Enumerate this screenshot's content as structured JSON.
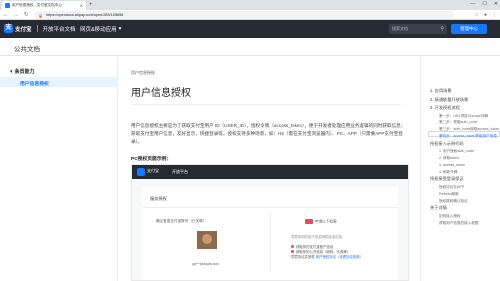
{
  "browser": {
    "tab_title": "用户信息授权 - 支付宝文档中心",
    "url": "https://opendocs.alipay.com/open/289/105656",
    "colors": {
      "accent": "#1677ff",
      "header_bg": "#262a33"
    }
  },
  "header": {
    "brand": "支付宝",
    "platform": "开放平台文档",
    "nav": "网页&移动应用",
    "search_placeholder": "搜索文档",
    "console_button": "管理中心"
  },
  "subheader": {
    "title": "公共文档"
  },
  "sidebar": {
    "group": "会员能力",
    "items": [
      {
        "label": "用户信息授权",
        "active": true
      }
    ]
  },
  "main": {
    "breadcrumb": "用户信息授权",
    "title": "用户信息授权",
    "paragraph": "用户信息授权主要是为了获取支付宝用户 ID（USER_ID），授权令牌（access_token），便于开发者处理应用业务逻辑的同时获取信息；获取支付宝用户信息，友好显示，快捷登录等。授权支持多种场景，如：H5（需在支付宝浏览器内）、PC、APP（只需要APP支付宝登录）。",
    "section_heading": "PC授权页面示例：",
    "screenshot": {
      "brand": "支付宝",
      "platform": "开放平台",
      "card_title": "服务授权",
      "left_label": "确认登录支付宝账号（已关联）",
      "email": "qq***@alipay.com",
      "right_label": "申请以下权限",
      "right_sub": "同意将你的如下信息授权给该应用：",
      "perm_1": "获取你的支付宝账户信息",
      "perm_2": "获取你的公开信息（昵称、头像等）",
      "agree_prefix": "同意协议并授权",
      "agree_link": "用户授权协议（查看协议条款）"
    }
  },
  "toc": [
    {
      "label": "1. 应用场景",
      "level": 0
    },
    {
      "label": "2. 接通能量开放场景",
      "level": 0
    },
    {
      "label": "3. 开发授权流程",
      "level": 0
    },
    {
      "label": "第一步：URL拼接与scope详解",
      "level": 1
    },
    {
      "label": "第二步：获取auth_code",
      "level": 1
    },
    {
      "label": "第三步：auth_code换取access_token",
      "level": 1
    },
    {
      "label": "第四步：access_token获取用户信息",
      "level": 1,
      "active": true
    },
    {
      "label": "授权接入示例代码",
      "level": 0
    },
    {
      "label": "1. 用户授权auth_code",
      "level": 1
    },
    {
      "label": "2. 获取token",
      "level": 1
    },
    {
      "label": "3. access_token",
      "level": 1
    },
    {
      "label": "4. 刷新令牌",
      "level": 1
    },
    {
      "label": "授权接受登录保证",
      "level": 0
    },
    {
      "label": "授权协议在APP",
      "level": 1
    },
    {
      "label": "Refresh刷新",
      "level": 1
    },
    {
      "label": "授权跳转确认验证",
      "level": 1
    },
    {
      "label": "关于详情",
      "level": 0
    },
    {
      "label": "如何接入授权",
      "level": 1
    },
    {
      "label": "获取用户信息的接入权限",
      "level": 1
    }
  ]
}
